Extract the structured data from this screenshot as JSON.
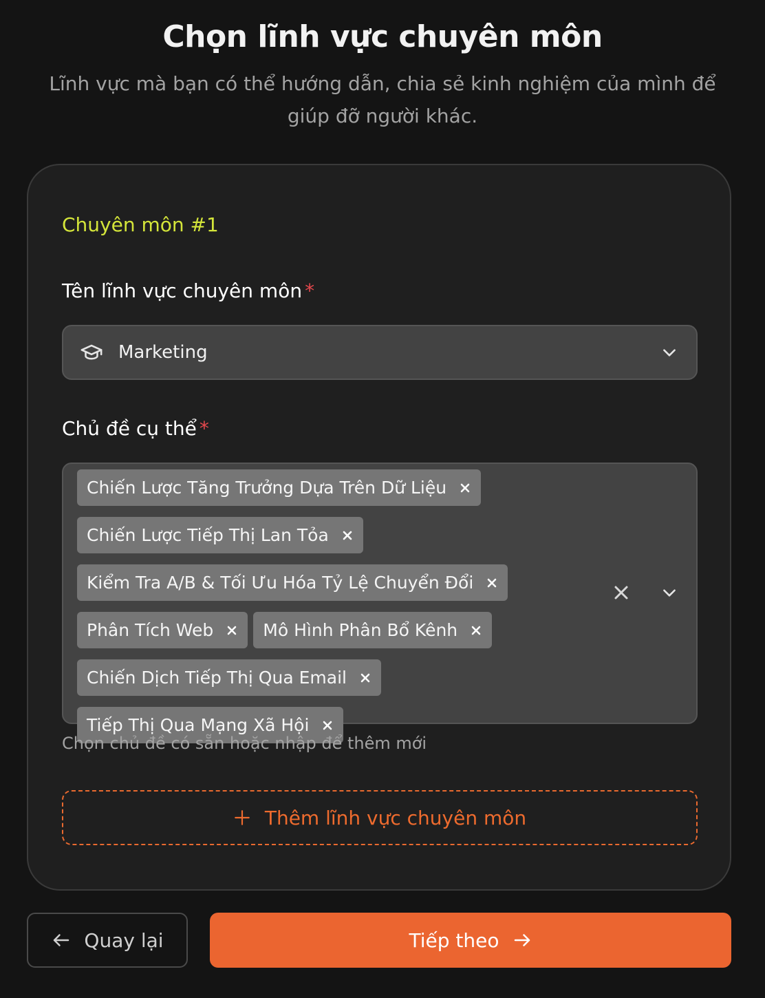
{
  "page": {
    "title": "Chọn lĩnh vực chuyên môn",
    "subtitle": "Lĩnh vực mà bạn có thể hướng dẫn, chia sẻ kinh nghiệm của mình để giúp đỡ người khác."
  },
  "expertise": {
    "section_title": "Chuyên môn #1",
    "field_label": "Tên lĩnh vực chuyên môn",
    "field_icon": "graduation-cap-icon",
    "field_value": "Marketing",
    "topics_label": "Chủ đề cụ thể",
    "required_mark": "*",
    "topics": [
      "Chiến Lược Tăng Trưởng Dựa Trên Dữ Liệu",
      "Chiến Lược Tiếp Thị Lan Tỏa",
      "Kiểm Tra A/B & Tối Ưu Hóa Tỷ Lệ Chuyển Đổi",
      "Phân Tích Web",
      "Mô Hình Phân Bổ Kênh",
      "Chiến Dịch Tiếp Thị Qua Email",
      "Tiếp Thị Qua Mạng Xã Hội"
    ],
    "topics_hint": "Chọn chủ đề có sẵn hoặc nhập để thêm mới",
    "add_button": "Thêm lĩnh vực chuyên môn"
  },
  "footer": {
    "back_label": "Quay lại",
    "next_label": "Tiếp theo"
  },
  "colors": {
    "background": "#141414",
    "accent": "#eb6530",
    "section_title": "#d4e53a",
    "required": "#e5484d"
  }
}
